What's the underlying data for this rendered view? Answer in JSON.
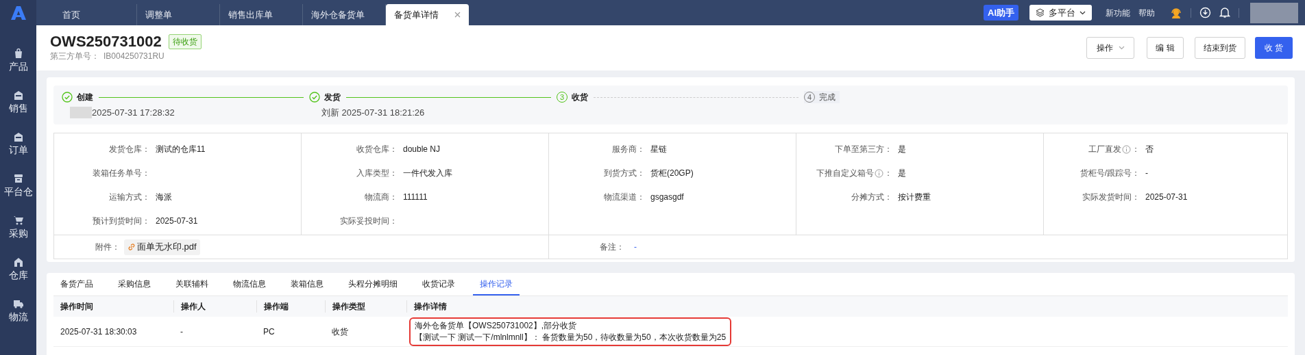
{
  "sidebar": {
    "items": [
      {
        "label": "产品"
      },
      {
        "label": "销售"
      },
      {
        "label": "订单"
      },
      {
        "label": "平台仓"
      },
      {
        "label": "采购"
      },
      {
        "label": "仓库"
      },
      {
        "label": "物流"
      }
    ]
  },
  "topbar": {
    "tabs": [
      {
        "label": "首页",
        "selected": false
      },
      {
        "label": "调整单",
        "selected": false
      },
      {
        "label": "销售出库单",
        "selected": false
      },
      {
        "label": "海外仓备货单",
        "selected": false
      },
      {
        "label": "备货单详情",
        "selected": true
      }
    ],
    "ai_button": "AI助手",
    "platform_select": "多平台",
    "links": [
      "新功能",
      "帮助"
    ]
  },
  "header": {
    "title": "OWS250731002",
    "status": "待收货",
    "third_party_label": "第三方单号：",
    "third_party_value": "IB004250731RU",
    "actions": [
      {
        "label": "操作",
        "kind": "dropdown"
      },
      {
        "label": "编 辑",
        "kind": "default"
      },
      {
        "label": "结束到货",
        "kind": "default"
      },
      {
        "label": "收 货",
        "kind": "primary"
      }
    ]
  },
  "steps": [
    {
      "label": "创建",
      "kind": "done",
      "name_hidden": true,
      "detail": "2025-07-31 17:28:32"
    },
    {
      "label": "发货",
      "kind": "done",
      "detail": "刘新 2025-07-31 18:21:26"
    },
    {
      "label": "收货",
      "kind": "current",
      "number": "3"
    },
    {
      "label": "完成",
      "kind": "pending",
      "number": "4"
    }
  ],
  "label_suffix": "：",
  "info_columns": [
    [
      {
        "label": "发货仓库",
        "value": "测试的仓库11"
      },
      {
        "label": "装箱任务单号"
      },
      {
        "label": "运输方式",
        "value": "海派"
      },
      {
        "label": "预计到货时间",
        "value": "2025-07-31"
      }
    ],
    [
      {
        "label": "收货仓库",
        "value": "double NJ"
      },
      {
        "label": "入库类型",
        "value": "一件代发入库"
      },
      {
        "label": "物流商",
        "value": "111111"
      },
      {
        "label": "实际妥投时间"
      }
    ],
    [
      {
        "label": "服务商",
        "value": "星链"
      },
      {
        "label": "到货方式",
        "value": "货柜(20GP)"
      },
      {
        "label": "物流渠道",
        "value": "gsgasgdf"
      }
    ],
    [
      {
        "label": "下单至第三方",
        "value": "是"
      },
      {
        "label": "下推自定义箱号",
        "value": "是",
        "info": true
      },
      {
        "label": "分摊方式",
        "value": "按计费重"
      }
    ],
    [
      {
        "label": "工厂直发",
        "value": "否",
        "info": true
      },
      {
        "label": "货柜号/跟踪号",
        "value": "-"
      },
      {
        "label": "实际发货时间",
        "value": "2025-07-31"
      }
    ]
  ],
  "attachment": {
    "label": "附件",
    "file": "面单无水印.pdf"
  },
  "remark": {
    "label": "备注",
    "value": "-"
  },
  "detail_tabs": [
    {
      "label": "备货产品",
      "selected": false
    },
    {
      "label": "采购信息",
      "selected": false
    },
    {
      "label": "关联辅料",
      "selected": false
    },
    {
      "label": "物流信息",
      "selected": false
    },
    {
      "label": "装箱信息",
      "selected": false
    },
    {
      "label": "头程分摊明细",
      "selected": false
    },
    {
      "label": "收货记录",
      "selected": false
    },
    {
      "label": "操作记录",
      "selected": true
    }
  ],
  "table": {
    "columns": [
      "操作时间",
      "操作人",
      "操作端",
      "操作类型",
      "操作详情"
    ],
    "rows": [
      {
        "cells": [
          "2025-07-31 18:30:03",
          "-",
          "PC",
          "收货"
        ],
        "detail": [
          "海外仓备货单【OWS250731002】,部分收货",
          "【测试一下 测试一下/mlnlmnll】： 备货数量为50，待收数量为50，本次收货数量为25"
        ],
        "highlighted": true
      }
    ]
  }
}
